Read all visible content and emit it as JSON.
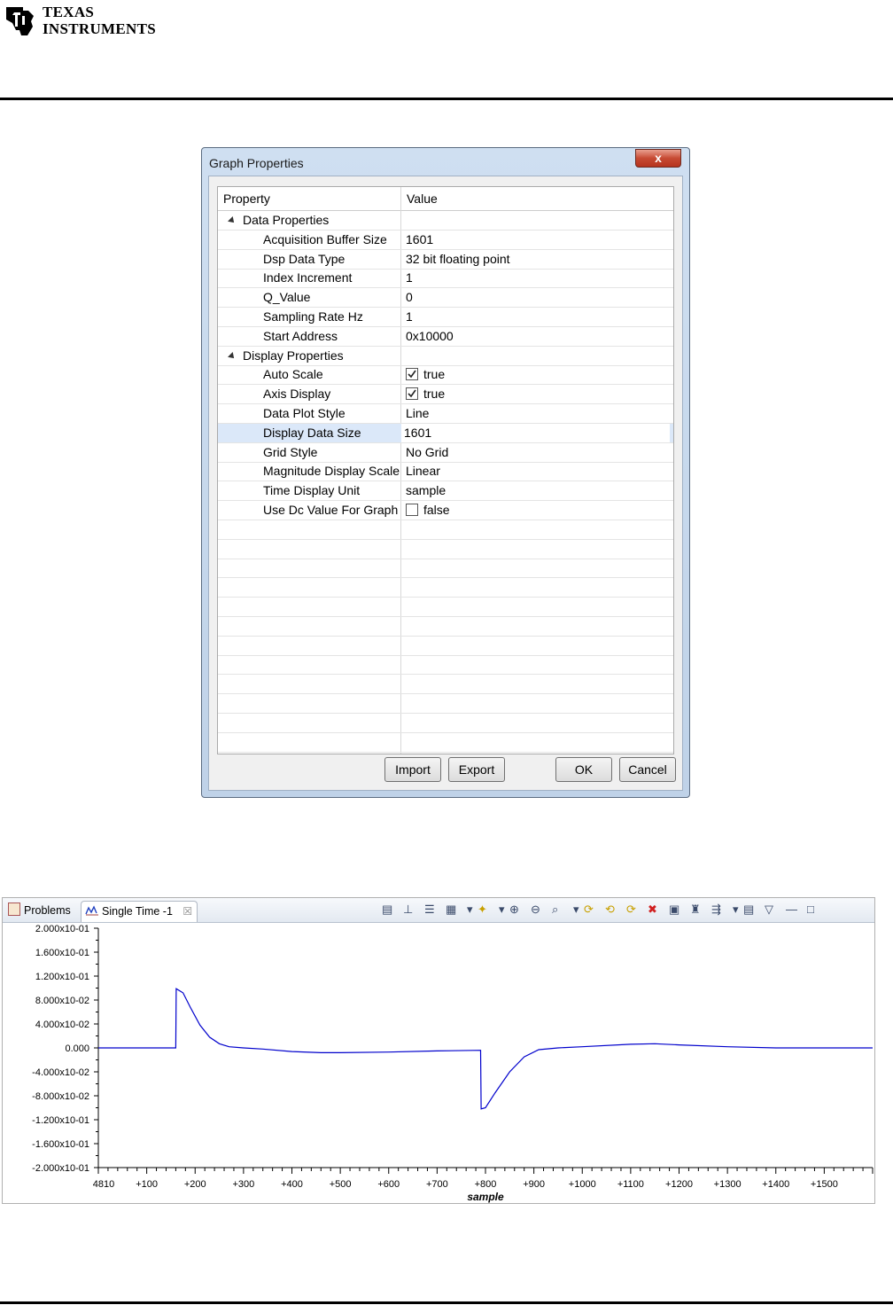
{
  "header": {
    "logo_line1": "TEXAS",
    "logo_line2": "INSTRUMENTS"
  },
  "dialog": {
    "title": "Graph Properties",
    "close_label": "x",
    "columns": [
      "Property",
      "Value"
    ],
    "groups": [
      {
        "label": "Data Properties",
        "rows": [
          {
            "property": "Acquisition Buffer Size",
            "value": "1601"
          },
          {
            "property": "Dsp Data Type",
            "value": "32 bit floating point"
          },
          {
            "property": "Index Increment",
            "value": "1"
          },
          {
            "property": "Q_Value",
            "value": "0"
          },
          {
            "property": "Sampling Rate Hz",
            "value": "1"
          },
          {
            "property": "Start Address",
            "value": "0x10000"
          }
        ]
      },
      {
        "label": "Display Properties",
        "rows": [
          {
            "property": "Auto Scale",
            "value": "true",
            "checkbox": true,
            "checked": true
          },
          {
            "property": "Axis Display",
            "value": "true",
            "checkbox": true,
            "checked": true
          },
          {
            "property": "Data Plot Style",
            "value": "Line"
          },
          {
            "property": "Display Data Size",
            "value": "1601",
            "selected": true
          },
          {
            "property": "Grid Style",
            "value": "No Grid"
          },
          {
            "property": "Magnitude Display Scale",
            "value": "Linear"
          },
          {
            "property": "Time Display Unit",
            "value": "sample"
          },
          {
            "property": "Use Dc Value For Graph",
            "value": "false",
            "checkbox": true,
            "checked": false
          }
        ]
      }
    ],
    "buttons": {
      "import": "Import",
      "export": "Export",
      "ok": "OK",
      "cancel": "Cancel"
    }
  },
  "graph_panel": {
    "tabs": [
      {
        "label": "Problems"
      },
      {
        "label": "Single Time -1",
        "active": true
      }
    ],
    "tab_close": "☒",
    "toolbar_icons": [
      "align-icon",
      "cursor-icon",
      "legend-icon",
      "data-icon",
      "marker-icon",
      "zoom-in-icon",
      "zoom-out-icon",
      "zoom-fit-icon",
      "refresh-icon",
      "continuous-refresh-icon",
      "sync-icon",
      "clear-icon",
      "export-icon",
      "find-icon",
      "pin-icon",
      "save-icon",
      "properties-icon",
      "view-menu-icon",
      "minimize-icon",
      "maximize-icon"
    ]
  },
  "chart_data": {
    "type": "line",
    "xlabel": "sample",
    "ylabel": "",
    "xlim": [
      0,
      1600
    ],
    "ylim": [
      -0.2,
      0.2
    ],
    "y_ticks": [
      0.2,
      0.16,
      0.12,
      0.08,
      0.04,
      0.0,
      -0.04,
      -0.08,
      -0.12,
      -0.16,
      -0.2
    ],
    "y_tick_labels": [
      "2.000x10-01",
      "1.600x10-01",
      "1.200x10-01",
      "8.000x10-02",
      "4.000x10-02",
      "0.000",
      "-4.000x10-02",
      "-8.000x10-02",
      "-1.200x10-01",
      "-1.600x10-01",
      "-2.000x10-01"
    ],
    "x_ticks": [
      0,
      100,
      200,
      300,
      400,
      500,
      600,
      700,
      800,
      900,
      1000,
      1100,
      1200,
      1300,
      1400,
      1500
    ],
    "x_tick_labels": [
      "4810",
      "+100",
      "+200",
      "+300",
      "+400",
      "+500",
      "+600",
      "+700",
      "+800",
      "+900",
      "+1000",
      "+1100",
      "+1200",
      "+1300",
      "+1400",
      "+1500"
    ],
    "grid": false,
    "series": [
      {
        "color": "#0000cc",
        "x": [
          0,
          160,
          161,
          175,
          190,
          210,
          230,
          250,
          270,
          300,
          340,
          400,
          460,
          500,
          600,
          700,
          790,
          791,
          800,
          820,
          850,
          880,
          910,
          950,
          1000,
          1100,
          1150,
          1200,
          1300,
          1400,
          1500,
          1600
        ],
        "y": [
          0.0,
          0.0,
          0.099,
          0.092,
          0.068,
          0.038,
          0.018,
          0.007,
          0.002,
          0.0,
          -0.002,
          -0.006,
          -0.008,
          -0.008,
          -0.007,
          -0.005,
          -0.004,
          -0.102,
          -0.1,
          -0.075,
          -0.04,
          -0.015,
          -0.003,
          0.0,
          0.002,
          0.006,
          0.007,
          0.005,
          0.002,
          0.0,
          0.0,
          0.0
        ]
      }
    ]
  }
}
